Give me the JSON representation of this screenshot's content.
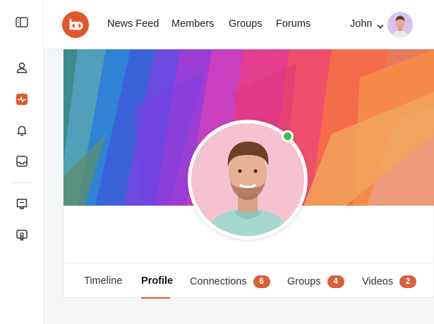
{
  "sidebar": {
    "items": [
      {
        "icon": "panel-toggle-icon"
      },
      {
        "icon": "user-icon"
      },
      {
        "icon": "activity-icon",
        "active": true
      },
      {
        "icon": "bell-icon"
      },
      {
        "icon": "inbox-icon"
      },
      {
        "icon": "course-icon"
      },
      {
        "icon": "certificate-icon"
      }
    ]
  },
  "header": {
    "logo": "buddyboss-logo-icon",
    "nav": [
      "News Feed",
      "Members",
      "Groups",
      "Forums"
    ],
    "user_name": "John"
  },
  "profile": {
    "online": true,
    "tabs": [
      {
        "label": "Timeline"
      },
      {
        "label": "Profile",
        "active": true
      },
      {
        "label": "Connections",
        "count": "6"
      },
      {
        "label": "Groups",
        "count": "4"
      },
      {
        "label": "Videos",
        "count": "2"
      }
    ]
  },
  "colors": {
    "accent": "#e2562b",
    "badge": "#d9603b",
    "online": "#32c252"
  }
}
